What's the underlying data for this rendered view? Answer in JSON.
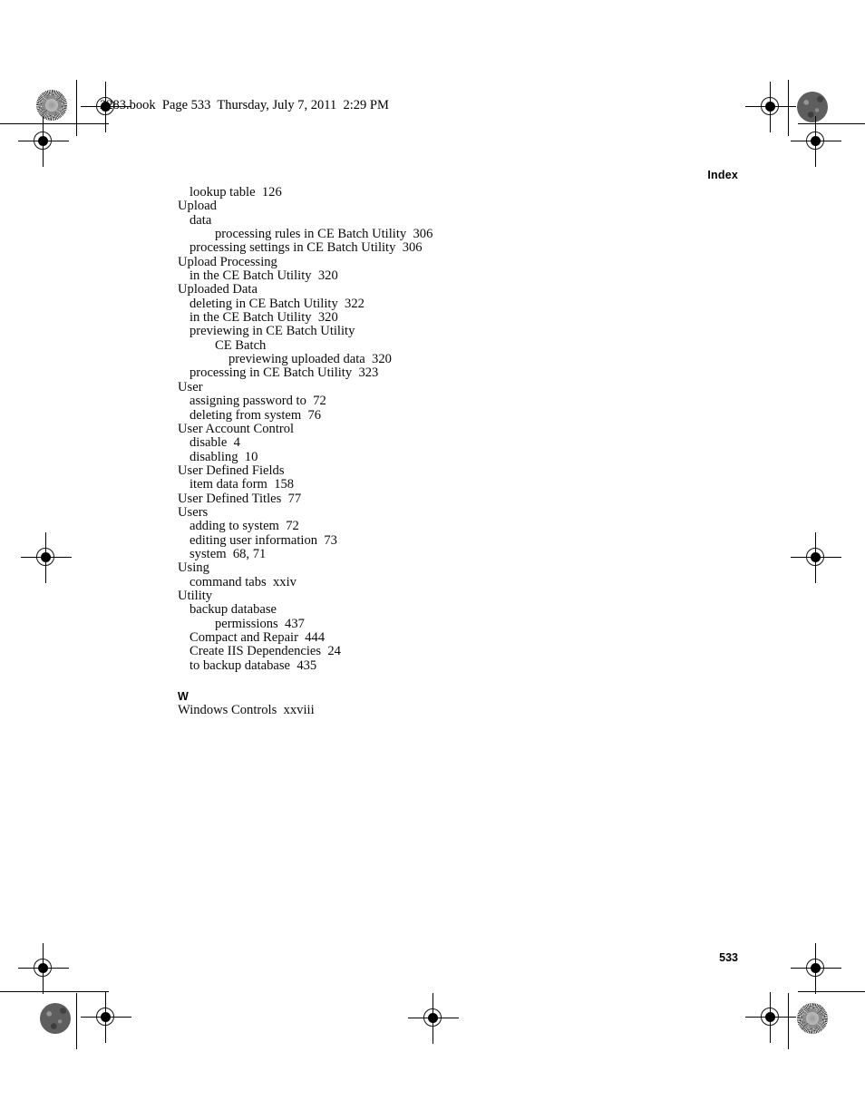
{
  "header": {
    "file_stamp": "2283.book  Page 533  Thursday, July 7, 2011  2:29 PM"
  },
  "running_head": "Index",
  "folio": "533",
  "index": {
    "entries": [
      {
        "level": 1,
        "text": "lookup table  126"
      },
      {
        "level": 0,
        "text": "Upload"
      },
      {
        "level": 1,
        "text": "data"
      },
      {
        "level": 2,
        "text": "processing rules in CE Batch Utility  306"
      },
      {
        "level": 1,
        "text": "processing settings in CE Batch Utility  306"
      },
      {
        "level": 0,
        "text": "Upload Processing"
      },
      {
        "level": 1,
        "text": "in the CE Batch Utility  320"
      },
      {
        "level": 0,
        "text": "Uploaded Data"
      },
      {
        "level": 1,
        "text": "deleting in CE Batch Utility  322"
      },
      {
        "level": 1,
        "text": "in the CE Batch Utility  320"
      },
      {
        "level": 1,
        "text": "previewing in CE Batch Utility"
      },
      {
        "level": 2,
        "text": "CE Batch"
      },
      {
        "level": 3,
        "text": "previewing uploaded data  320"
      },
      {
        "level": 1,
        "text": "processing in CE Batch Utility  323"
      },
      {
        "level": 0,
        "text": "User"
      },
      {
        "level": 1,
        "text": "assigning password to  72"
      },
      {
        "level": 1,
        "text": "deleting from system  76"
      },
      {
        "level": 0,
        "text": "User Account Control"
      },
      {
        "level": 1,
        "text": "disable  4"
      },
      {
        "level": 1,
        "text": "disabling  10"
      },
      {
        "level": 0,
        "text": "User Defined Fields"
      },
      {
        "level": 1,
        "text": "item data form  158"
      },
      {
        "level": 0,
        "text": "User Defined Titles  77"
      },
      {
        "level": 0,
        "text": "Users"
      },
      {
        "level": 1,
        "text": "adding to system  72"
      },
      {
        "level": 1,
        "text": "editing user information  73"
      },
      {
        "level": 1,
        "text": "system  68, 71"
      },
      {
        "level": 0,
        "text": "Using"
      },
      {
        "level": 1,
        "text": "command tabs  xxiv"
      },
      {
        "level": 0,
        "text": "Utility"
      },
      {
        "level": 1,
        "text": "backup database"
      },
      {
        "level": 2,
        "text": "permissions  437"
      },
      {
        "level": 1,
        "text": "Compact and Repair  444"
      },
      {
        "level": 1,
        "text": "Create IIS Dependencies  24"
      },
      {
        "level": 1,
        "text": "to backup database  435"
      }
    ],
    "letter_section": {
      "letter": "W",
      "entries": [
        {
          "level": 0,
          "text": "Windows Controls  xxviii"
        }
      ]
    }
  },
  "printer_marks": {
    "registration_label": "registration-target",
    "density_patch_label": "density-patch"
  }
}
